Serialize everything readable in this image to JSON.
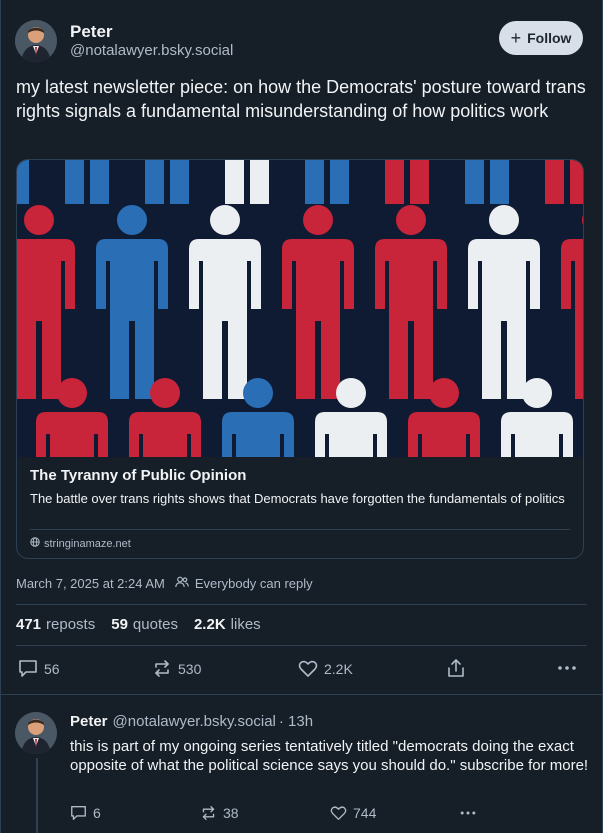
{
  "post": {
    "author_name": "Peter",
    "author_handle": "@notalawyer.bsky.social",
    "follow_label": "Follow",
    "text": "my latest newsletter piece: on how the Democrats' posture toward trans rights signals a fundamental misunderstanding of how politics work",
    "link_card": {
      "title": "The Tyranny of Public Opinion",
      "description": "The battle over trans rights shows that Democrats have forgotten the fundamentals of politics",
      "domain": "stringinamaze.net"
    },
    "timestamp": "March 7, 2025 at 2:24 AM",
    "reply_setting": "Everybody can reply",
    "stats": {
      "reposts_count": "471",
      "reposts_label": "reposts",
      "quotes_count": "59",
      "quotes_label": "quotes",
      "likes_count": "2.2K",
      "likes_label": "likes"
    },
    "actions": {
      "replies": "56",
      "reposts": "530",
      "likes": "2.2K"
    }
  },
  "reply": {
    "author_name": "Peter",
    "author_handle": "@notalawyer.bsky.social",
    "time": "· 13h",
    "text": "this is part of my ongoing series tentatively titled \"democrats doing the exact opposite of what the political science says you should do.\" subscribe for more!",
    "actions": {
      "replies": "6",
      "reposts": "38",
      "likes": "744"
    }
  },
  "colors": {
    "background": "#161e27",
    "border": "#2e4052",
    "muted_text": "#aebbc9",
    "figure_red": "#c8243a",
    "figure_blue": "#2a6fb5",
    "figure_white": "#eceff2"
  },
  "icons": [
    "globe-icon",
    "people-icon",
    "reply-icon",
    "repost-icon",
    "heart-icon",
    "share-icon",
    "more-icon"
  ]
}
